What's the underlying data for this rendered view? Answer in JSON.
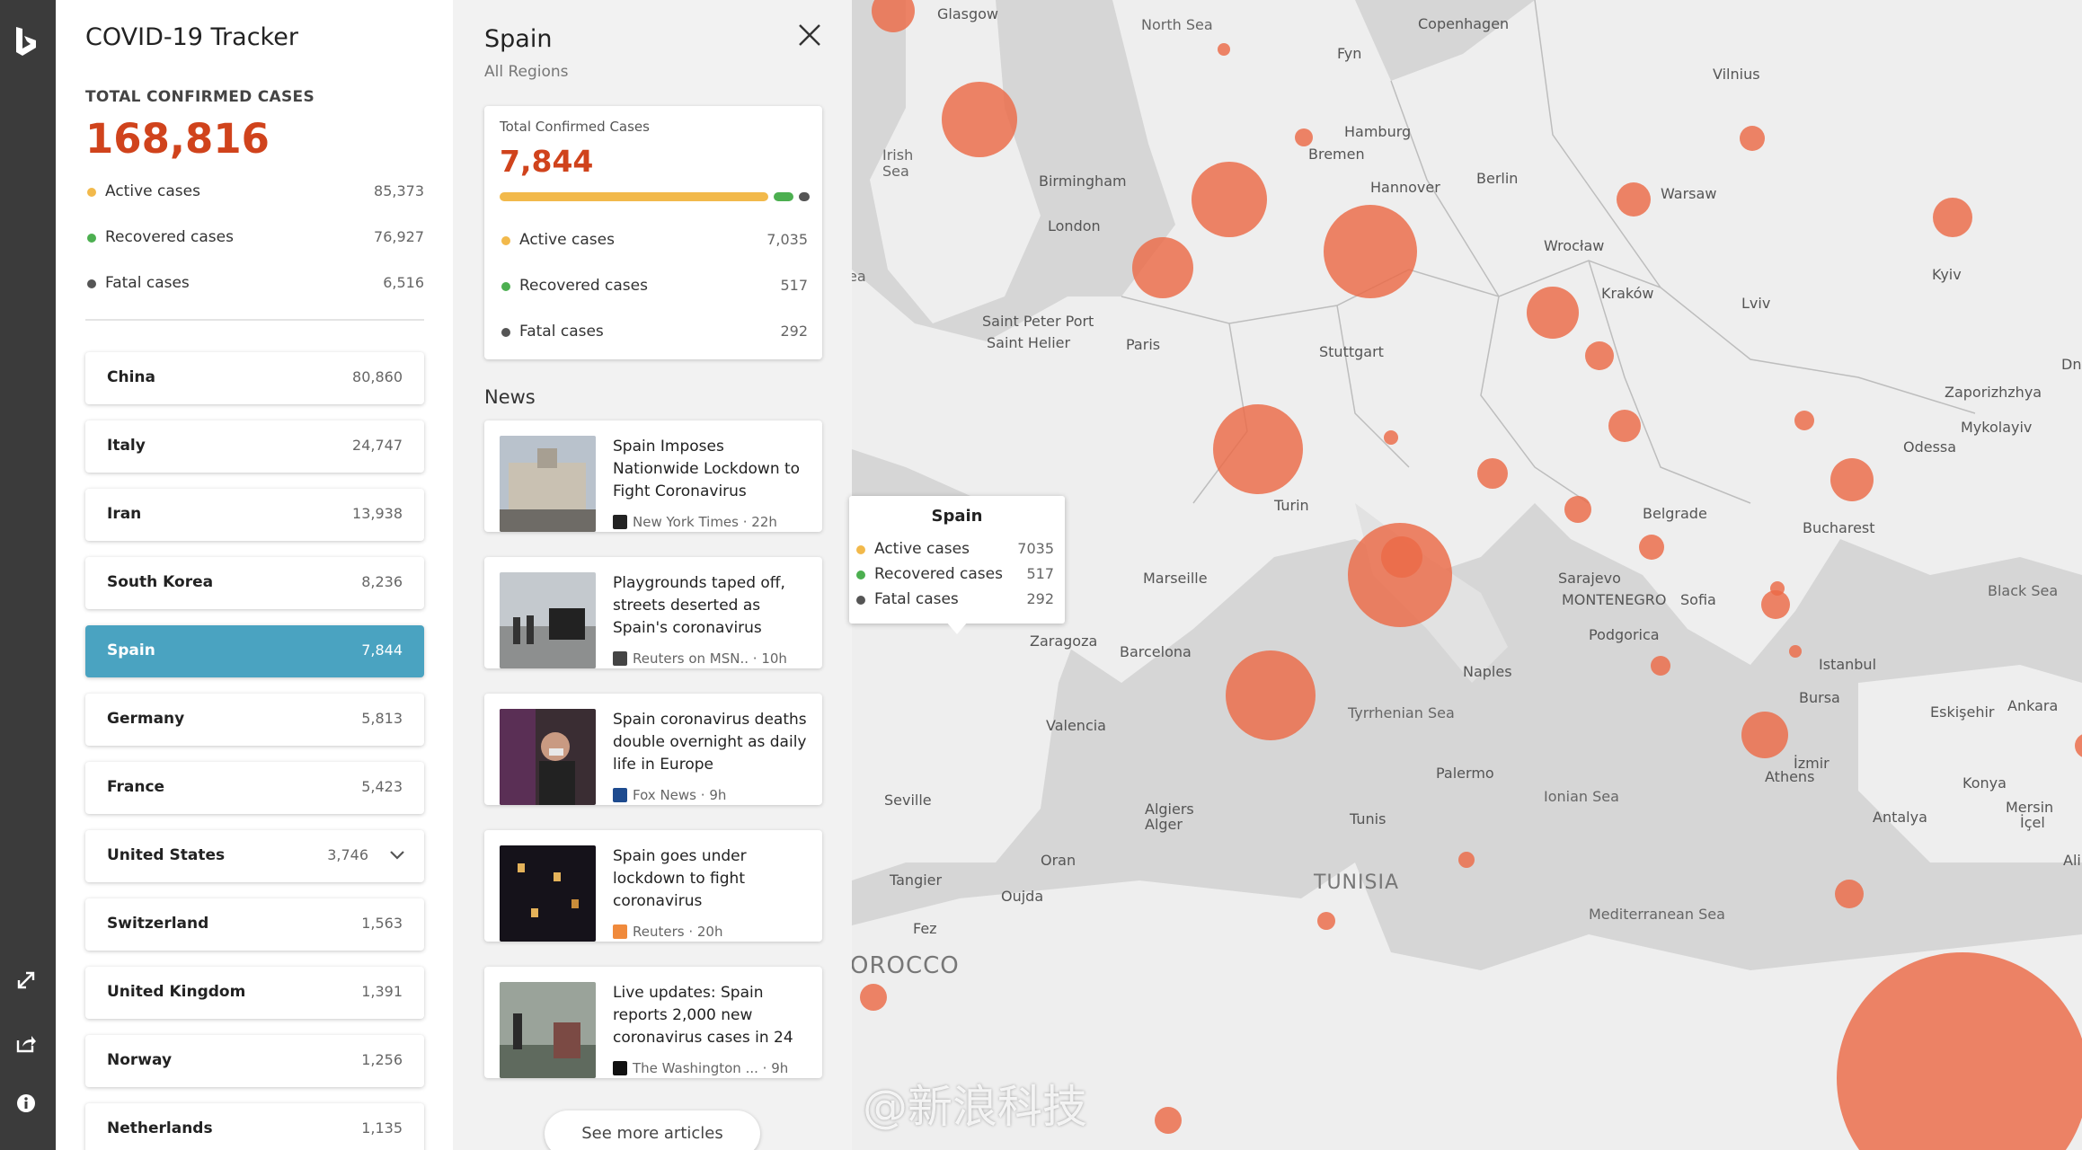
{
  "rail": {
    "logo_icon": "bing-logo",
    "buttons": [
      "expand-icon",
      "share-icon",
      "info-icon"
    ]
  },
  "tracker": {
    "title": "COVID-19 Tracker",
    "total_label": "TOTAL CONFIRMED CASES",
    "total_value": "168,816",
    "legend": [
      {
        "label": "Active cases",
        "value": "85,373",
        "color": "#f2b94b"
      },
      {
        "label": "Recovered cases",
        "value": "76,927",
        "color": "#4caf50"
      },
      {
        "label": "Fatal cases",
        "value": "6,516",
        "color": "#555555"
      }
    ],
    "countries": [
      {
        "name": "China",
        "value": "80,860"
      },
      {
        "name": "Italy",
        "value": "24,747"
      },
      {
        "name": "Iran",
        "value": "13,938"
      },
      {
        "name": "South Korea",
        "value": "8,236"
      },
      {
        "name": "Spain",
        "value": "7,844",
        "selected": true
      },
      {
        "name": "Germany",
        "value": "5,813"
      },
      {
        "name": "France",
        "value": "5,423"
      },
      {
        "name": "United States",
        "value": "3,746",
        "expandable": true
      },
      {
        "name": "Switzerland",
        "value": "1,563"
      },
      {
        "name": "United Kingdom",
        "value": "1,391"
      },
      {
        "name": "Norway",
        "value": "1,256"
      },
      {
        "name": "Netherlands",
        "value": "1,135"
      }
    ]
  },
  "detail": {
    "title": "Spain",
    "subtitle": "All Regions",
    "card": {
      "label": "Total Confirmed Cases",
      "value": "7,844",
      "legend": [
        {
          "label": "Active cases",
          "value": "7,035",
          "color": "#f2b94b"
        },
        {
          "label": "Recovered cases",
          "value": "517",
          "color": "#4caf50"
        },
        {
          "label": "Fatal cases",
          "value": "292",
          "color": "#555555"
        }
      ],
      "bar_fractions": [
        0.897,
        0.066,
        0.037
      ]
    },
    "news_title": "News",
    "news": [
      {
        "headline": "Spain Imposes Nationwide Lockdown to Fight Coronavirus",
        "source": "New York Times",
        "age": "22h",
        "thumb": "#8a8f98"
      },
      {
        "headline": "Playgrounds taped off, streets deserted as Spain's coronavirus",
        "source": "Reuters on MSN..",
        "age": "10h",
        "thumb": "#7d868f"
      },
      {
        "headline": "Spain coronavirus deaths double overnight as daily life in Europe",
        "source": "Fox News",
        "age": "9h",
        "thumb": "#5a4a52"
      },
      {
        "headline": "Spain goes under lockdown to fight coronavirus",
        "source": "Reuters",
        "age": "20h",
        "thumb": "#1d1a22"
      },
      {
        "headline": "Live updates: Spain reports 2,000 new coronavirus cases in 24",
        "source": "The Washington ...",
        "age": "9h",
        "thumb": "#6f7a6c"
      }
    ],
    "more_label": "See more articles"
  },
  "map": {
    "tooltip": {
      "title": "Spain",
      "rows": [
        {
          "label": "Active cases",
          "value": "7035",
          "color": "#f2b94b"
        },
        {
          "label": "Recovered cases",
          "value": "517",
          "color": "#4caf50"
        },
        {
          "label": "Fatal cases",
          "value": "292",
          "color": "#555555"
        }
      ]
    },
    "cities": [
      "Glasgow",
      "Fyn",
      "Copenhagen",
      "Vilnius",
      "Hamburg",
      "Bremen",
      "Hannover",
      "Berlin",
      "Warsaw",
      "Birmingham",
      "London",
      "Wrocław",
      "Kraków",
      "Lviv",
      "Kyiv",
      "Saint Peter Port",
      "Saint Helier",
      "Paris",
      "Stuttgart",
      "Zaporizhzhya",
      "Mykolayiv",
      "Odessa",
      "Turin",
      "Belgrade",
      "Bucharest",
      "Marseille",
      "Sarajevo",
      "MONTENEGRO",
      "Sofia",
      "Zaragoza",
      "Barcelona",
      "Podgorica",
      "Naples",
      "Istanbul",
      "Valencia",
      "Bursa",
      "Eskişehir",
      "Ankara",
      "İzmir",
      "Athens",
      "Seville",
      "Palermo",
      "Konya",
      "Algiers",
      "Alger",
      "Tunis",
      "Antalya",
      "Mersin",
      "İçel",
      "Oran",
      "Tangier",
      "Oujda",
      "Fez",
      "Dni",
      "Ali"
    ],
    "seas": [
      "North Sea",
      "Irish Sea",
      "Black Sea",
      "Tyrrhenian Sea",
      "Ionian Sea",
      "Mediterranean Sea",
      "ea"
    ],
    "country_labels": [
      "TUNISIA",
      "OROCCO"
    ],
    "watermark": "@新浪科技",
    "bubble_color": "#ec6a47"
  }
}
